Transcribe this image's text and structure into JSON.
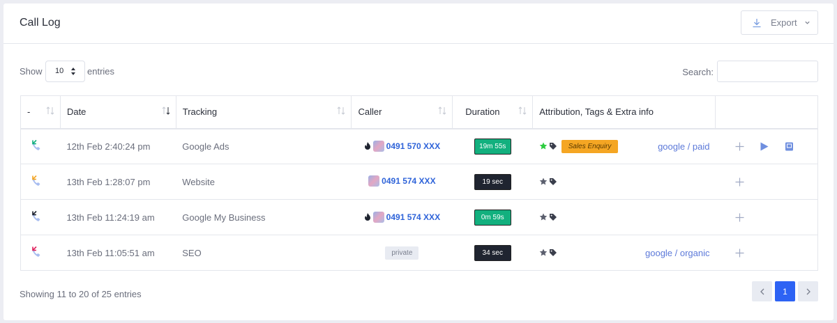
{
  "header": {
    "title": "Call Log",
    "export_label": "Export"
  },
  "controls": {
    "show_label": "Show",
    "entries_value": "10",
    "entries_label": "entries",
    "search_label": "Search:",
    "search_value": ""
  },
  "table": {
    "columns": [
      "-",
      "Date",
      "Tracking",
      "Caller",
      "Duration",
      "Attribution, Tags & Extra info",
      ""
    ],
    "rows": [
      {
        "direction_color": "#12b07e",
        "date": "12th Feb 2:40:24 pm",
        "tracking": "Google Ads",
        "hot": true,
        "caller": "0491 570 XXX",
        "private": false,
        "duration": "19m 55s",
        "duration_style": "green",
        "starred": true,
        "star_color": "#2ecc40",
        "tag_label": "Sales Enquiry",
        "source": "google / paid",
        "has_recording": true
      },
      {
        "direction_color": "#f5a623",
        "date": "13th Feb 1:28:07 pm",
        "tracking": "Website",
        "hot": false,
        "caller": "0491 574 XXX",
        "private": false,
        "duration": "19 sec",
        "duration_style": "dark",
        "starred": false,
        "star_color": "#5b5f6e",
        "tag_label": "",
        "source": "",
        "has_recording": false
      },
      {
        "direction_color": "#1f2430",
        "date": "13th Feb 11:24:19 am",
        "tracking": "Google My Business",
        "hot": true,
        "caller": "0491 574 XXX",
        "private": false,
        "duration": "0m 59s",
        "duration_style": "green",
        "starred": false,
        "star_color": "#5b5f6e",
        "tag_label": "",
        "source": "",
        "has_recording": false
      },
      {
        "direction_color": "#e0245e",
        "date": "13th Feb 11:05:51 am",
        "tracking": "SEO",
        "hot": false,
        "caller": "",
        "private": true,
        "private_label": "private",
        "duration": "34 sec",
        "duration_style": "dark",
        "starred": false,
        "star_color": "#5b5f6e",
        "tag_label": "",
        "source": "google / organic",
        "has_recording": false
      }
    ]
  },
  "footer": {
    "info": "Showing 11 to 20 of 25 entries",
    "current_page": "1"
  },
  "colors": {
    "accent": "#2e63f4",
    "link": "#2e63d9",
    "source": "#5c79d9",
    "badge": "#f5a623"
  },
  "icons": [
    "download-icon",
    "chevron-down-icon",
    "sort-icon",
    "phone-icon",
    "flame-icon",
    "flag-icon",
    "star-icon",
    "tag-icon",
    "plus-icon",
    "play-icon",
    "book-icon",
    "chevron-left-icon",
    "chevron-right-icon"
  ]
}
